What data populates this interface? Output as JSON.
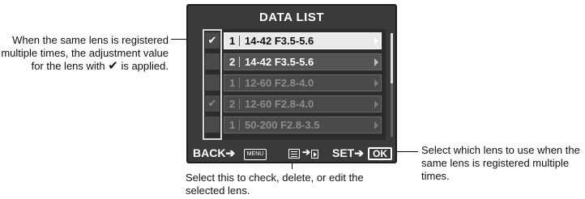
{
  "screen": {
    "title": "DATA LIST",
    "rows": [
      {
        "check": "✔",
        "num": "1",
        "name": "14-42 F3.5-5.6",
        "state": "selected"
      },
      {
        "check": "",
        "num": "2",
        "name": "14-42 F3.5-5.6",
        "state": "normal"
      },
      {
        "check": "",
        "num": "1",
        "name": "12-60 F2.8-4.0",
        "state": "dim"
      },
      {
        "check": "✔",
        "num": "2",
        "name": "12-60 F2.8-4.0",
        "state": "dim"
      },
      {
        "check": "",
        "num": "1",
        "name": "50-200 F2.8-3.5",
        "state": "dim"
      }
    ],
    "footer": {
      "back_label": "BACK➔",
      "menu_label": "MENU",
      "info_arrow": "➔",
      "set_label": "SET➔",
      "ok_label": "OK"
    }
  },
  "annotations": {
    "left": "When the same lens is registered multiple times, the adjustment value for the lens with",
    "left_suffix": " is applied.",
    "check_icon": "✔",
    "right": "Select which lens to use when the same lens is registered multiple times.",
    "bottom": "Select this to check, delete, or edit the selected lens."
  }
}
